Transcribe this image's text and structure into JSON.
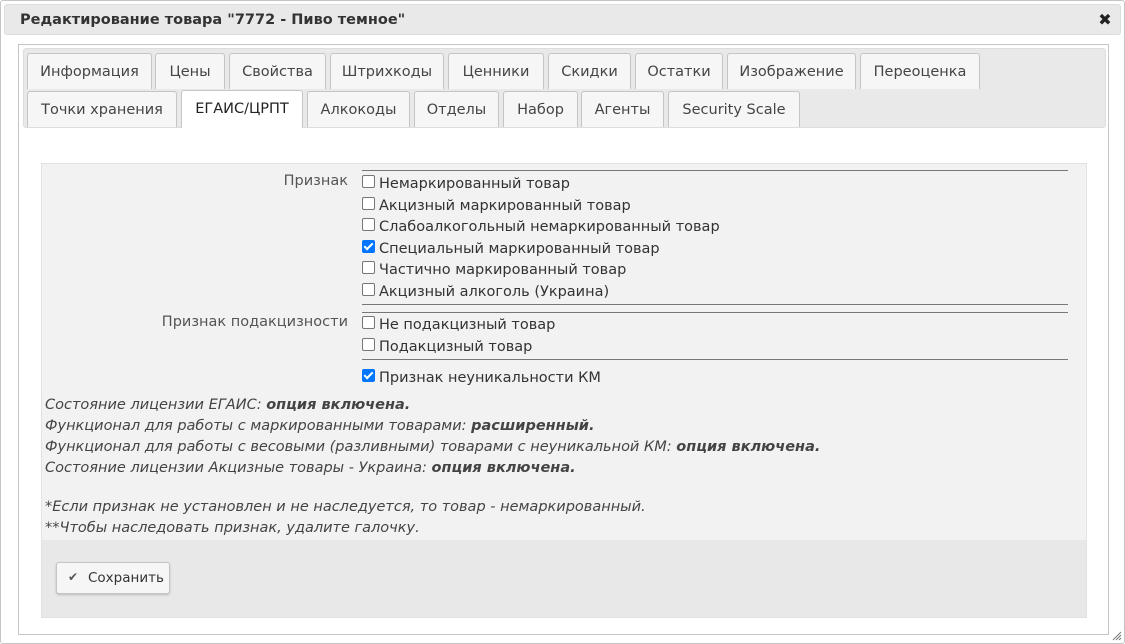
{
  "dialog": {
    "title": "Редактирование товара \"7772 - Пиво темное\"",
    "close_icon": "close-icon"
  },
  "tabs": {
    "row1": [
      "Информация",
      "Цены",
      "Свойства",
      "Штрихкоды",
      "Ценники",
      "Скидки",
      "Остатки",
      "Изображение",
      "Переоценка"
    ],
    "row2": [
      "Точки хранения",
      "ЕГАИС/ЦРПТ",
      "Алкокоды",
      "Отделы",
      "Набор",
      "Агенты",
      "Security Scale"
    ],
    "active": "ЕГАИС/ЦРПТ"
  },
  "form": {
    "priznak_label": "Признак",
    "priznak_options": [
      {
        "label": "Немаркированный товар",
        "checked": false
      },
      {
        "label": "Акцизный маркированный товар",
        "checked": false
      },
      {
        "label": "Слабоалкогольный немаркированный товар",
        "checked": false
      },
      {
        "label": "Специальный маркированный товар",
        "checked": true
      },
      {
        "label": "Частично маркированный товар",
        "checked": false
      },
      {
        "label": "Акцизный алкоголь (Украина)",
        "checked": false
      }
    ],
    "podakciz_label": "Признак подакцизности",
    "podakciz_options": [
      {
        "label": "Не подакцизный товар",
        "checked": false
      },
      {
        "label": "Подакцизный товар",
        "checked": false
      }
    ],
    "nonunique": {
      "label": "Признак неуникальности КМ",
      "checked": true
    }
  },
  "info": {
    "lines": [
      {
        "text": "Состояние лицензии ЕГАИС: ",
        "value": "опция включена."
      },
      {
        "text": "Функционал для работы с маркированными товарами: ",
        "value": "расширенный."
      },
      {
        "text": "Функционал для работы с весовыми (разливными) товарами с неуникальной КМ: ",
        "value": "опция включена."
      },
      {
        "text": "Состояние лицензии Акцизные товары - Украина: ",
        "value": "опция включена."
      }
    ],
    "notes": [
      "*Если признак не установлен и не наследуется, то товар - немаркированный.",
      "**Чтобы наследовать признак, удалите галочку."
    ]
  },
  "footer": {
    "save_label": "Сохранить",
    "save_icon": "checkmark-icon"
  },
  "colors": {
    "accent": "#0075ff",
    "titlebar": "#e9e9e9",
    "panel": "#f2f2f2"
  }
}
